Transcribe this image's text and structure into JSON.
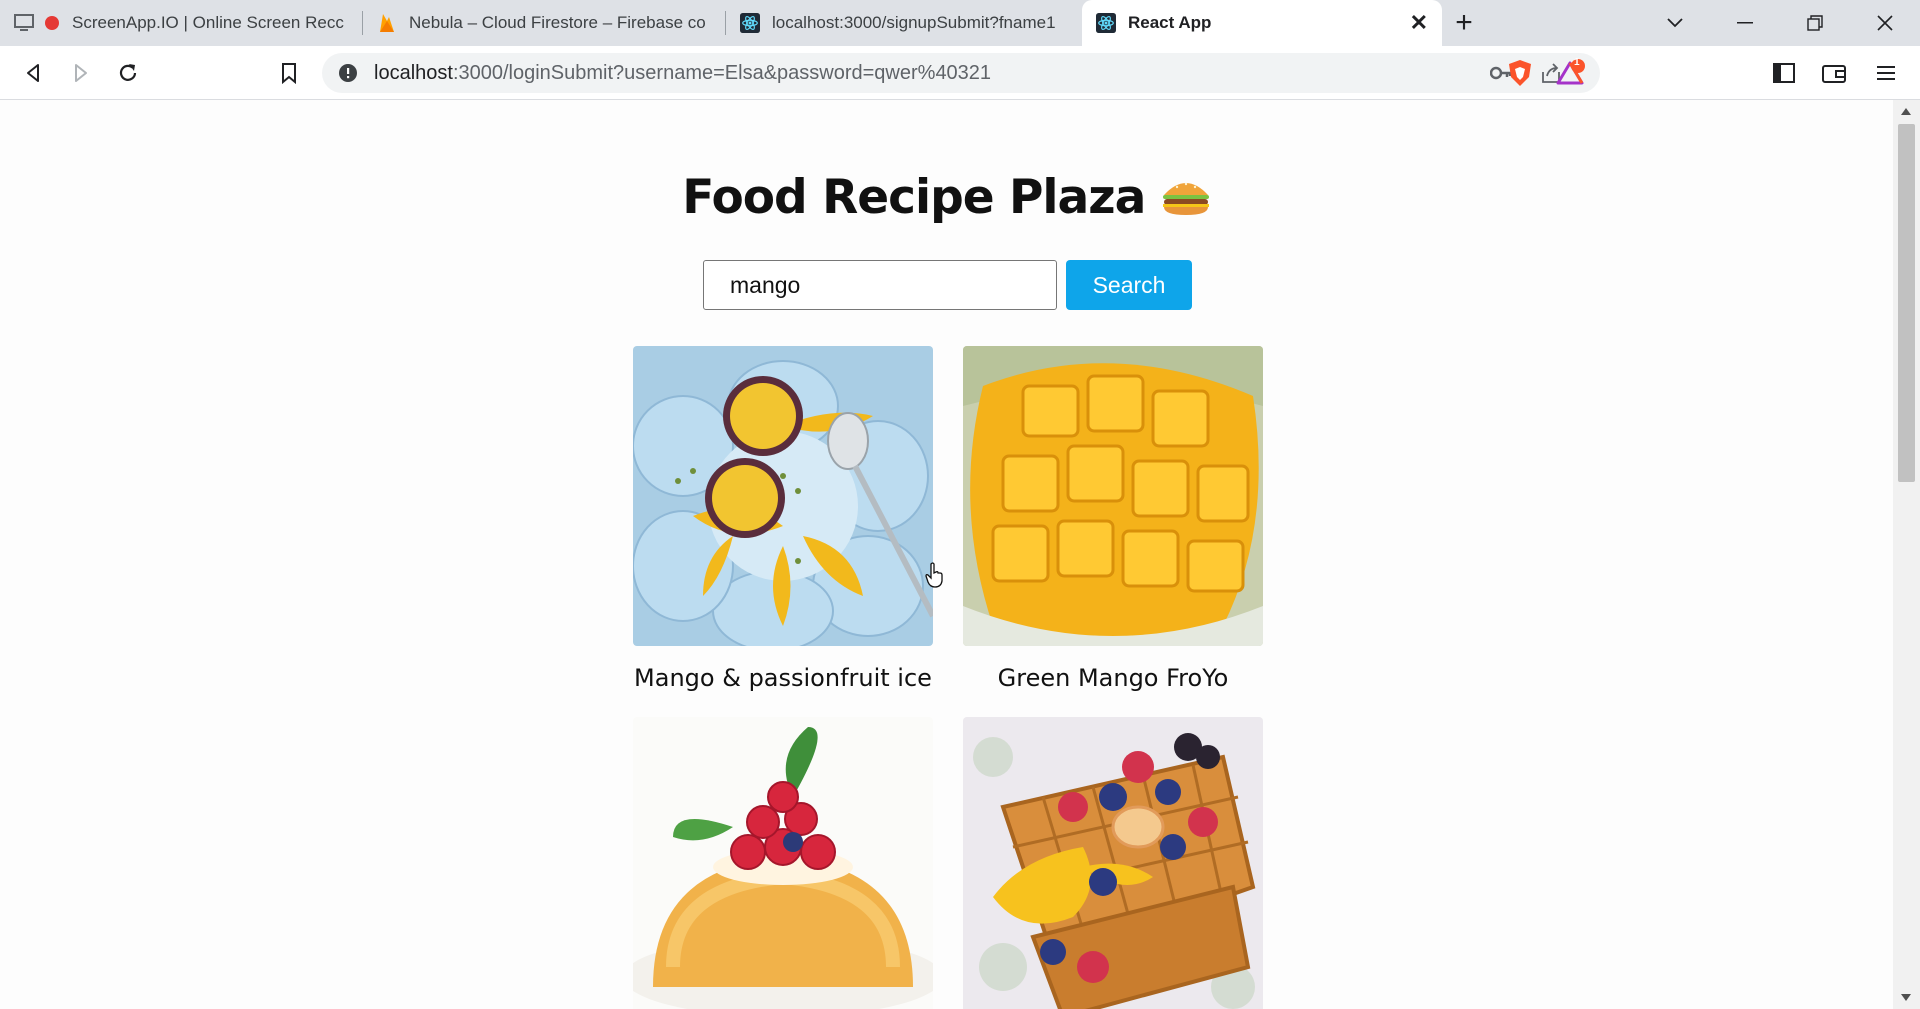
{
  "browser": {
    "tabs": [
      {
        "label": "ScreenApp.IO | Online Screen Recc",
        "icon": "screen-recording-icon"
      },
      {
        "label": "Nebula – Cloud Firestore – Firebase co",
        "icon": "firebase-icon"
      },
      {
        "label": "localhost:3000/signupSubmit?fname1",
        "icon": "react-icon"
      },
      {
        "label": "React App",
        "icon": "react-icon",
        "active": true
      }
    ],
    "url_host": "localhost",
    "url_rest": ":3000/loginSubmit?username=Elsa&password=qwer%40321",
    "notification_badge": "1"
  },
  "page": {
    "title": "Food Recipe Plaza",
    "title_emoji": "🍔",
    "search": {
      "value": "mango",
      "button_label": "Search"
    },
    "recipes": [
      {
        "name": "Mango & passionfruit ice"
      },
      {
        "name": "Green Mango FroYo"
      },
      {
        "name": ""
      },
      {
        "name": ""
      }
    ]
  },
  "colors": {
    "search_button": "#0ea5ea",
    "tabbar": "#dee1e6"
  }
}
